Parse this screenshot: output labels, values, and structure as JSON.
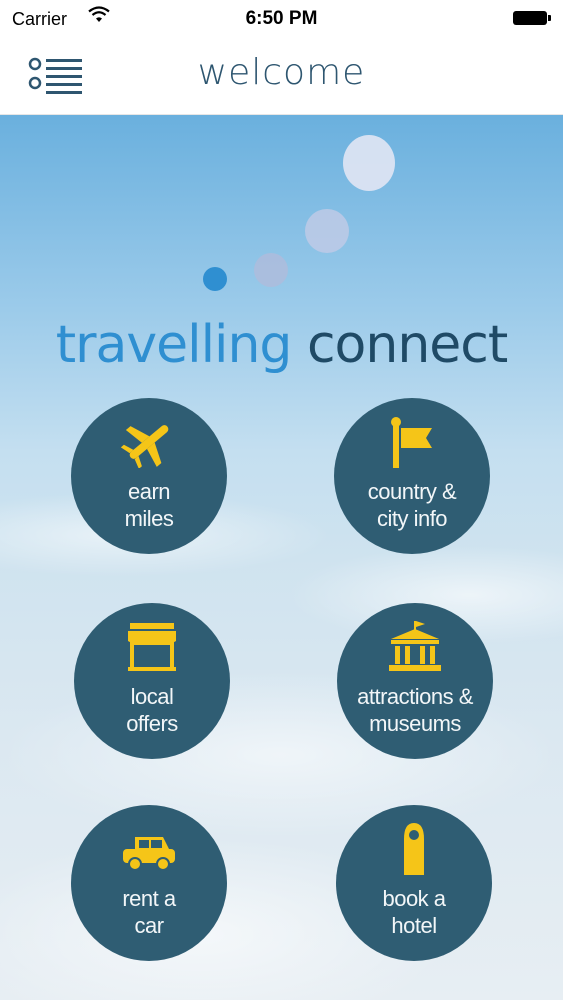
{
  "status_bar": {
    "carrier": "Carrier",
    "time": "6:50 PM"
  },
  "nav": {
    "title": "welcome"
  },
  "brand": {
    "word1": "travelling",
    "word2": "connect"
  },
  "tiles": [
    {
      "line1": "earn",
      "line2": "miles",
      "icon": "airplane-icon"
    },
    {
      "line1": "country &",
      "line2": "city info",
      "icon": "flag-icon"
    },
    {
      "line1": "local",
      "line2": "offers",
      "icon": "storefront-icon"
    },
    {
      "line1": "attractions &",
      "line2": "museums",
      "icon": "museum-icon"
    },
    {
      "line1": "rent a",
      "line2": "car",
      "icon": "car-icon"
    },
    {
      "line1": "book a",
      "line2": "hotel",
      "icon": "door-hanger-icon"
    }
  ],
  "colors": {
    "tile_bg": "#2f5d73",
    "icon_yellow": "#f5c518",
    "brand_light": "#2f8fd1",
    "brand_dark": "#1f4a66"
  }
}
